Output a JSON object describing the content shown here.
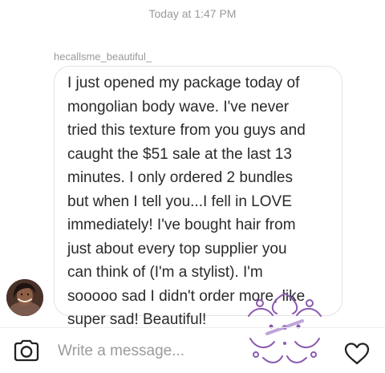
{
  "conversation": {
    "timestamp": "Today at 1:47 PM",
    "sender": "hecallsme_beautiful_",
    "message_lines": [
      "I just opened my package today of",
      "mongolian body wave. I've never",
      "tried this texture from you guys and",
      "caught the $51 sale at the last 13",
      "minutes. I only ordered 2 bundles",
      "but when I tell you...I fell in LOVE",
      "immediately! I've bought hair from",
      "just about every top supplier you",
      "can think of  (I'm a stylist). I'm",
      "sooooo sad I didn't order more, like",
      "super sad! Beautiful!"
    ]
  },
  "composer": {
    "placeholder": "Write a message..."
  },
  "icons": {
    "camera": "camera-icon",
    "heart": "heart-icon"
  },
  "colors": {
    "watermark": "#8a5ab0"
  }
}
